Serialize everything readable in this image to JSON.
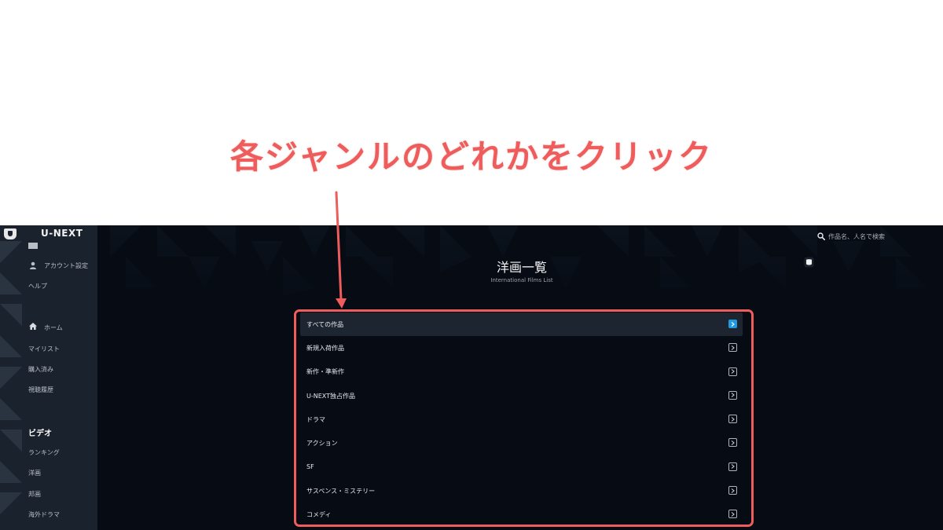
{
  "annotation": {
    "headline": "各ジャンルのどれかをクリック",
    "color": "#ee5c5c"
  },
  "app": {
    "brand": "U-NEXT",
    "header": {
      "search_placeholder": "作品名、人名で検索"
    },
    "sidebar": {
      "top_items": [
        {
          "label": "アカウント設定",
          "icon": "person-icon"
        },
        {
          "label": "ヘルプ"
        }
      ],
      "main_items": [
        {
          "label": "ホーム",
          "icon": "home-icon"
        },
        {
          "label": "マイリスト"
        },
        {
          "label": "購入済み"
        },
        {
          "label": "視聴履歴"
        }
      ],
      "section_heading": "ビデオ",
      "video_items": [
        {
          "label": "ランキング"
        },
        {
          "label": "洋画"
        },
        {
          "label": "邦画"
        },
        {
          "label": "海外ドラマ"
        }
      ]
    },
    "page": {
      "title": "洋画一覧",
      "subtitle": "International Films List"
    },
    "genres": [
      {
        "label": "すべての作品",
        "active": true
      },
      {
        "label": "新規入荷作品"
      },
      {
        "label": "新作・準新作"
      },
      {
        "label": "U-NEXT独占作品"
      },
      {
        "label": "ドラマ"
      },
      {
        "label": "アクション"
      },
      {
        "label": "SF"
      },
      {
        "label": "サスペンス・ミステリー"
      },
      {
        "label": "コメディ"
      }
    ],
    "colors": {
      "background": "#060b14",
      "sidebar": "#1a222d",
      "accent": "#1f9ae0",
      "highlight": "#ee5c5c"
    }
  }
}
